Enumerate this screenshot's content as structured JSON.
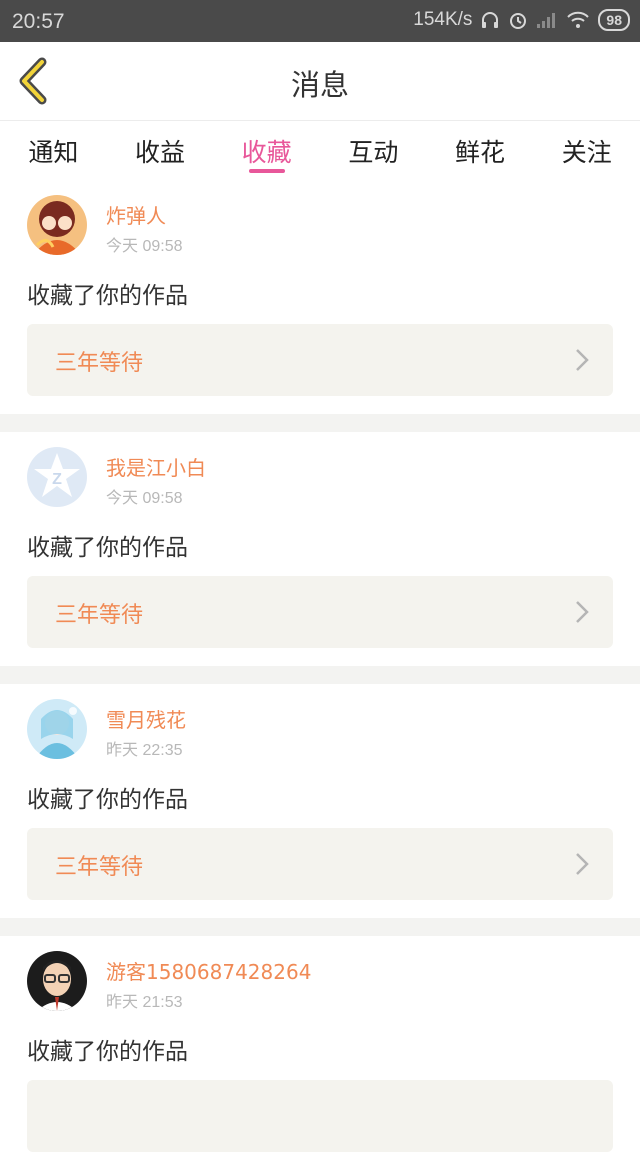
{
  "status_bar": {
    "time": "20:57",
    "speed": "154K/s",
    "battery": "98"
  },
  "header": {
    "title": "消息"
  },
  "tabs": [
    {
      "label": "通知"
    },
    {
      "label": "收益"
    },
    {
      "label": "收藏",
      "active": true
    },
    {
      "label": "互动"
    },
    {
      "label": "鲜花"
    },
    {
      "label": "关注"
    }
  ],
  "items": [
    {
      "user": "炸弹人",
      "time": "今天 09:58",
      "action": "收藏了你的作品",
      "work": "三年等待"
    },
    {
      "user": "我是江小白",
      "time": "今天 09:58",
      "action": "收藏了你的作品",
      "work": "三年等待"
    },
    {
      "user": "雪月残花",
      "time": "昨天 22:35",
      "action": "收藏了你的作品",
      "work": "三年等待"
    },
    {
      "user": "游客1580687428264",
      "time": "昨天 21:53",
      "action": "收藏了你的作品",
      "work": ""
    }
  ],
  "colors": {
    "accent": "#e8579a",
    "name": "#f08a55",
    "box": "#f4f3ee"
  }
}
